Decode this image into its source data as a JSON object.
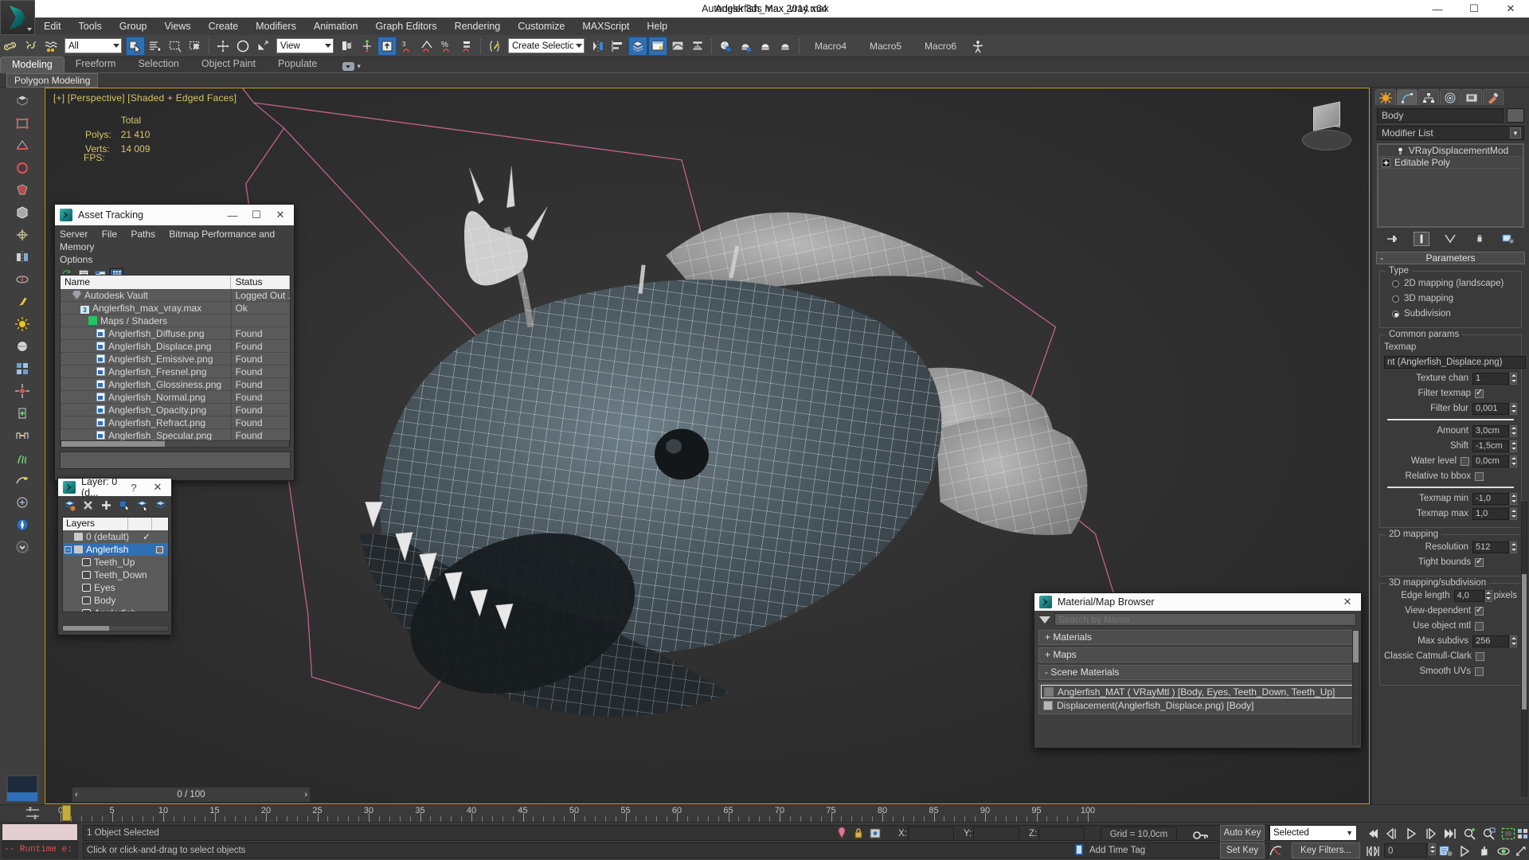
{
  "app": {
    "title": "Autodesk 3ds Max  2014 x64",
    "file": "Anglerfish_max_vray.max",
    "min_label": "—",
    "max_label": "☐",
    "close_label": "✕"
  },
  "menu": {
    "items": [
      "Edit",
      "Tools",
      "Group",
      "Views",
      "Create",
      "Modifiers",
      "Animation",
      "Graph Editors",
      "Rendering",
      "Customize",
      "MAXScript",
      "Help"
    ]
  },
  "toolbar": {
    "selection_filter": "All",
    "reference_coord": "View",
    "named_selection_set": "Create Selection Se",
    "macros": [
      "Macro4",
      "Macro5",
      "Macro6"
    ]
  },
  "ribbon": {
    "tabs": [
      "Modeling",
      "Freeform",
      "Selection",
      "Object Paint",
      "Populate"
    ],
    "active_tab": "Modeling",
    "panel_label": "Polygon Modeling"
  },
  "viewport": {
    "label": "[+] [Perspective] [Shaded + Edged Faces]",
    "stats_header": "Total",
    "polys_label": "Polys:",
    "polys_value": "21 410",
    "verts_label": "Verts:",
    "verts_value": "14 009",
    "fps_label": "FPS:"
  },
  "asset_tracking": {
    "title": "Asset Tracking",
    "menu": [
      "Server",
      "File",
      "Paths",
      "Bitmap Performance and Memory",
      "Options"
    ],
    "columns": [
      "Name",
      "Status"
    ],
    "rows": [
      {
        "name": "Autodesk Vault",
        "status": "Logged Out ...",
        "indent": 1,
        "icon": "vault-icon"
      },
      {
        "name": "Anglerfish_max_vray.max",
        "status": "Ok",
        "indent": 2,
        "icon": "max-file-icon"
      },
      {
        "name": "Maps / Shaders",
        "status": "",
        "indent": 3,
        "icon": "shader-icon"
      },
      {
        "name": "Anglerfish_Diffuse.png",
        "status": "Found",
        "indent": 4,
        "icon": "png-icon"
      },
      {
        "name": "Anglerfish_Displace.png",
        "status": "Found",
        "indent": 4,
        "icon": "png-icon"
      },
      {
        "name": "Anglerfish_Emissive.png",
        "status": "Found",
        "indent": 4,
        "icon": "png-icon"
      },
      {
        "name": "Anglerfish_Fresnel.png",
        "status": "Found",
        "indent": 4,
        "icon": "png-icon"
      },
      {
        "name": "Anglerfish_Glossiness.png",
        "status": "Found",
        "indent": 4,
        "icon": "png-icon"
      },
      {
        "name": "Anglerfish_Normal.png",
        "status": "Found",
        "indent": 4,
        "icon": "png-icon"
      },
      {
        "name": "Anglerfish_Opacity.png",
        "status": "Found",
        "indent": 4,
        "icon": "png-icon"
      },
      {
        "name": "Anglerfish_Refract.png",
        "status": "Found",
        "indent": 4,
        "icon": "png-icon"
      },
      {
        "name": "Anglerfish_Specular.png",
        "status": "Found",
        "indent": 4,
        "icon": "png-icon"
      }
    ]
  },
  "layer_dialog": {
    "title": "Layer: 0 (d...",
    "help_label": "?",
    "close_label": "✕",
    "column_header": "Layers",
    "rows": [
      {
        "label": "0 (default)",
        "type": "layer",
        "selected": false,
        "current": true,
        "indent": 1
      },
      {
        "label": "Anglerfish",
        "type": "layer",
        "selected": true,
        "current": false,
        "indent": 1,
        "expanded": true
      },
      {
        "label": "Teeth_Up",
        "type": "object",
        "selected": false,
        "indent": 2
      },
      {
        "label": "Teeth_Down",
        "type": "object",
        "selected": false,
        "indent": 2
      },
      {
        "label": "Eyes",
        "type": "object",
        "selected": false,
        "indent": 2
      },
      {
        "label": "Body",
        "type": "object",
        "selected": false,
        "indent": 2
      },
      {
        "label": "Anglerfish",
        "type": "object",
        "selected": false,
        "indent": 2
      }
    ]
  },
  "material_browser": {
    "title": "Material/Map Browser",
    "close_label": "✕",
    "search_placeholder": "Search by Name ...",
    "search_value": "",
    "groups": [
      {
        "label": "+ Materials",
        "expanded": false
      },
      {
        "label": "+ Maps",
        "expanded": false
      },
      {
        "label": "-  Scene Materials",
        "expanded": true
      }
    ],
    "scene_materials": [
      {
        "label": "Anglerfish_MAT  ( VRayMtl )  [Body, Eyes, Teeth_Down, Teeth_Up]",
        "selected": true,
        "swatch": "#8f8f8f"
      },
      {
        "label": "Displacement(Anglerfish_Displace.png) [Body]",
        "selected": false,
        "swatch": "#b6b6b6"
      }
    ]
  },
  "command_panel": {
    "tabs": [
      "create-tab",
      "modify-tab",
      "hierarchy-tab",
      "motion-tab",
      "display-tab",
      "utilities-tab"
    ],
    "active_tab_index": 1,
    "object_name": "Body",
    "modifier_list_label": "Modifier List",
    "modifier_stack": [
      {
        "label": "VRayDisplacementMod",
        "icon": "light-bulb-icon"
      },
      {
        "label": "Editable Poly",
        "icon": "plus-box-icon"
      }
    ],
    "parameters": {
      "rollout_label": "Parameters",
      "rollout_minus": "-",
      "type_group": "Type",
      "type_options": [
        {
          "label": "2D mapping (landscape)",
          "selected": false
        },
        {
          "label": "3D mapping",
          "selected": false
        },
        {
          "label": "Subdivision",
          "selected": true
        }
      ],
      "common_group": "Common params",
      "texmap_label": "Texmap",
      "texmap_value": "nt (Anglerfish_Displace.png)",
      "texture_chan_label": "Texture chan",
      "texture_chan_value": "1",
      "filter_texmap_label": "Filter texmap",
      "filter_texmap_checked": true,
      "filter_blur_label": "Filter blur",
      "filter_blur_value": "0,001",
      "amount_label": "Amount",
      "amount_value": "3,0cm",
      "shift_label": "Shift",
      "shift_value": "-1,5cm",
      "water_level_label": "Water level",
      "water_level_checked": false,
      "water_level_value": "0,0cm",
      "relative_bbox_label": "Relative to bbox",
      "relative_bbox_checked": false,
      "texmap_min_label": "Texmap min",
      "texmap_min_value": "-1,0",
      "texmap_max_label": "Texmap max",
      "texmap_max_value": "1,0",
      "mapping2d_group": "2D mapping",
      "resolution_label": "Resolution",
      "resolution_value": "512",
      "tight_bounds_label": "Tight bounds",
      "tight_bounds_checked": true,
      "mapping3d_group": "3D mapping/subdivision",
      "edge_length_label": "Edge length",
      "edge_length_value": "4,0",
      "edge_length_unit": "pixels",
      "view_dependent_label": "View-dependent",
      "view_dependent_checked": true,
      "use_object_mtl_label": "Use object mtl",
      "use_object_mtl_checked": false,
      "max_subdivs_label": "Max subdivs",
      "max_subdivs_value": "256",
      "classic_cc_label": "Classic Catmull-Clark",
      "classic_cc_checked": false,
      "smooth_uvs_label": "Smooth UVs",
      "smooth_uvs_checked": false
    }
  },
  "timeline": {
    "frame_readout": "0 / 100",
    "prev_label": "‹",
    "next_label": "›",
    "tick_labels": [
      "0",
      "5",
      "10",
      "15",
      "20",
      "25",
      "30",
      "35",
      "40",
      "45",
      "50",
      "55",
      "60",
      "65",
      "70",
      "75",
      "80",
      "85",
      "90",
      "95",
      "100"
    ],
    "current_frame": "0"
  },
  "status_bar": {
    "mxs_prompt": "-- Runtime e:",
    "selection_status": "1 Object Selected",
    "prompt": "Click or click-and-drag to select objects",
    "x_label": "X:",
    "x_value": "",
    "y_label": "Y:",
    "y_value": "",
    "z_label": "Z:",
    "z_value": "",
    "grid_label": "Grid = 10,0cm",
    "add_time_tag": "Add Time Tag",
    "auto_key": "Auto Key",
    "set_key": "Set Key",
    "key_mode": "Selected",
    "key_filters": "Key Filters...",
    "key_frame_value": "0"
  },
  "colors": {
    "accent_blue": "#2f6fb5",
    "viewport_border": "#c9a227",
    "stats_yellow": "#d8c56a",
    "spline_pink": "#c4628a",
    "panel_bg": "#3a3a3a",
    "error_red": "#e05050"
  }
}
